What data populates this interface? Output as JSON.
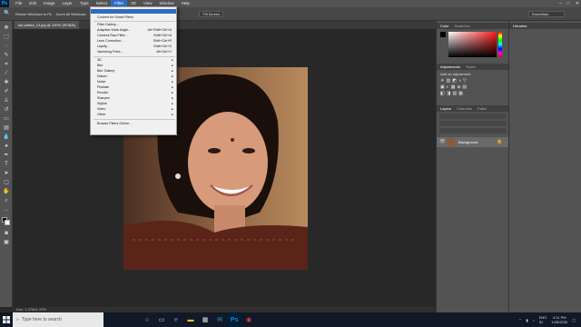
{
  "app": {
    "logo": "Ps"
  },
  "menubar": {
    "items": [
      "File",
      "Edit",
      "Image",
      "Layer",
      "Type",
      "Select",
      "Filter",
      "3D",
      "View",
      "Window",
      "Help"
    ],
    "active_index": 6
  },
  "window_controls": [
    "–",
    "□",
    "✕"
  ],
  "optbar": {
    "zoom_resize": "Resize Windows to Fit",
    "zoom_all": "Zoom All Windows",
    "fill_screen": "Fill Screen",
    "workspace": "Essentials"
  },
  "document": {
    "tab_label": "sai pallavi_13.jpg @ 100% (RGB/8)",
    "status": "Doc: 1.37M/1.37M"
  },
  "filter_menu": {
    "items": [
      {
        "label": "",
        "shortcut": "",
        "highlighted": true
      },
      {
        "label": "Convert for Smart Filters",
        "shortcut": ""
      },
      {
        "label": "Filter Gallery...",
        "shortcut": ""
      },
      {
        "label": "Adaptive Wide Angle...",
        "shortcut": "Alt+Shift+Ctrl+A"
      },
      {
        "label": "Camera Raw Filter...",
        "shortcut": "Shift+Ctrl+A"
      },
      {
        "label": "Lens Correction...",
        "shortcut": "Shift+Ctrl+R"
      },
      {
        "label": "Liquify...",
        "shortcut": "Shift+Ctrl+X"
      },
      {
        "label": "Vanishing Point...",
        "shortcut": "Alt+Ctrl+V"
      },
      {
        "label": "3D",
        "submenu": true
      },
      {
        "label": "Blur",
        "submenu": true
      },
      {
        "label": "Blur Gallery",
        "submenu": true
      },
      {
        "label": "Distort",
        "submenu": true
      },
      {
        "label": "Noise",
        "submenu": true
      },
      {
        "label": "Pixelate",
        "submenu": true
      },
      {
        "label": "Render",
        "submenu": true
      },
      {
        "label": "Sharpen",
        "submenu": true
      },
      {
        "label": "Stylize",
        "submenu": true
      },
      {
        "label": "Video",
        "submenu": true
      },
      {
        "label": "Other",
        "submenu": true
      },
      {
        "label": "Browse Filters Online..."
      }
    ]
  },
  "panels": {
    "color_tabs": [
      "Color",
      "Swatches"
    ],
    "adjustments_tabs": [
      "Adjustments",
      "Styles"
    ],
    "adjustments_label": "Add an adjustment",
    "layers_tabs": [
      "Layers",
      "Channels",
      "Paths"
    ],
    "layer_name": "Background",
    "libraries_tab": "Libraries"
  },
  "taskbar": {
    "search_placeholder": "Type here to search",
    "lang": "ENG",
    "region": "IN",
    "time": "4:11 PM",
    "date": "1/28/2020"
  },
  "colors": {
    "accent": "#2f6cc0",
    "panel": "#535353",
    "canvas": "#282828"
  }
}
